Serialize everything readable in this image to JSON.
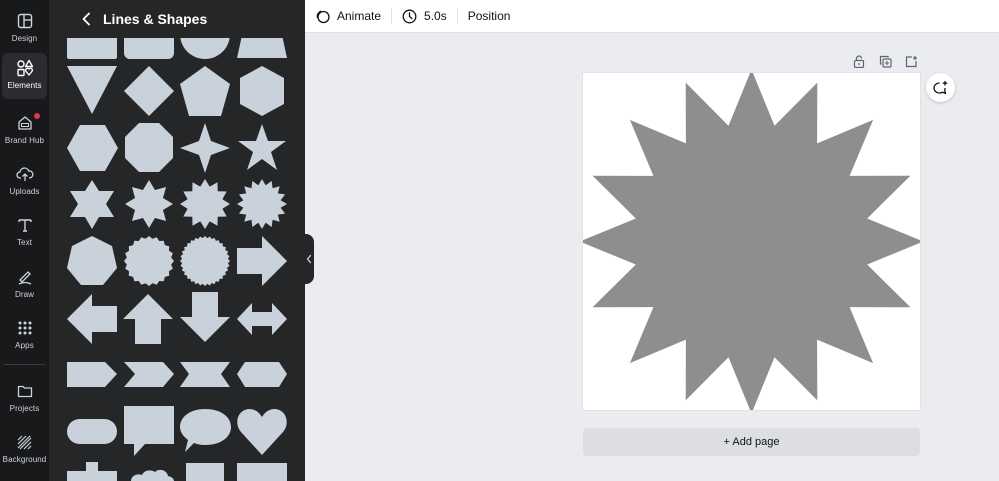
{
  "rail": {
    "items": [
      {
        "label": "Design",
        "icon": "design-icon"
      },
      {
        "label": "Elements",
        "icon": "elements-icon"
      },
      {
        "label": "Brand Hub",
        "icon": "brand-hub-icon"
      },
      {
        "label": "Uploads",
        "icon": "upload-cloud-icon"
      },
      {
        "label": "Text",
        "icon": "text-icon"
      },
      {
        "label": "Draw",
        "icon": "draw-icon"
      },
      {
        "label": "Apps",
        "icon": "apps-grid-icon"
      },
      {
        "label": "Projects",
        "icon": "folder-icon"
      },
      {
        "label": "Background",
        "icon": "background-pattern-icon"
      }
    ],
    "active": "Elements"
  },
  "panel": {
    "title": "Lines & Shapes",
    "shapes": [
      "rectangle",
      "rounded-rectangle",
      "half-circle",
      "trapezoid",
      "triangle-down",
      "diamond",
      "pentagon",
      "hexagon-vertical",
      "hexagon",
      "octagon",
      "star-4",
      "star-5",
      "star-6",
      "star-8",
      "star-12",
      "starburst-16",
      "heptagon",
      "seal-20",
      "seal-32",
      "arrow-right",
      "arrow-left",
      "arrow-up",
      "arrow-down",
      "arrow-double",
      "pentagon-arrow",
      "chevron",
      "ribbon-banner",
      "hexagon-tag",
      "pill",
      "speech-bubble-square",
      "speech-bubble-round",
      "heart",
      "cross",
      "cloud",
      "square",
      "rectangle-wide"
    ]
  },
  "toolbar": {
    "animate_label": "Animate",
    "duration_label": "5.0s",
    "position_label": "Position"
  },
  "canvas": {
    "add_page_label": "+ Add page",
    "shape": "starburst-16",
    "shape_color": "#8e8e8e",
    "shape_grid_color": "#c9d1db"
  },
  "colors": {
    "rail_bg": "#18191b",
    "panel_bg": "#252627",
    "workspace_bg": "#ebecf0"
  }
}
